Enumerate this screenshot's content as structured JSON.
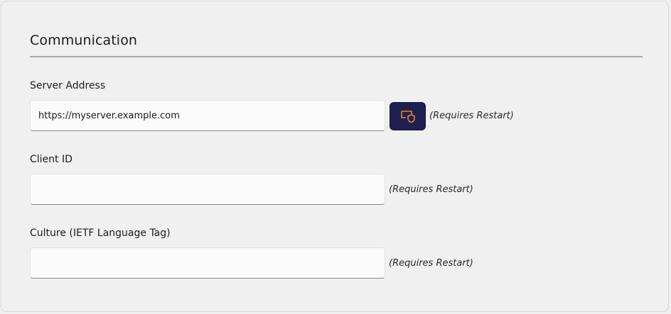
{
  "section": {
    "title": "Communication"
  },
  "fields": {
    "server_address": {
      "label": "Server Address",
      "value": "https://myserver.example.com",
      "note": "(Requires Restart)",
      "button_icon": "shield-certificate-icon",
      "button_color": "#1f2050",
      "icon_color": "#e8862a"
    },
    "client_id": {
      "label": "Client ID",
      "value": "",
      "note": "(Requires Restart)"
    },
    "culture": {
      "label": "Culture (IETF Language Tag)",
      "value": "",
      "note": "(Requires Restart)"
    }
  }
}
